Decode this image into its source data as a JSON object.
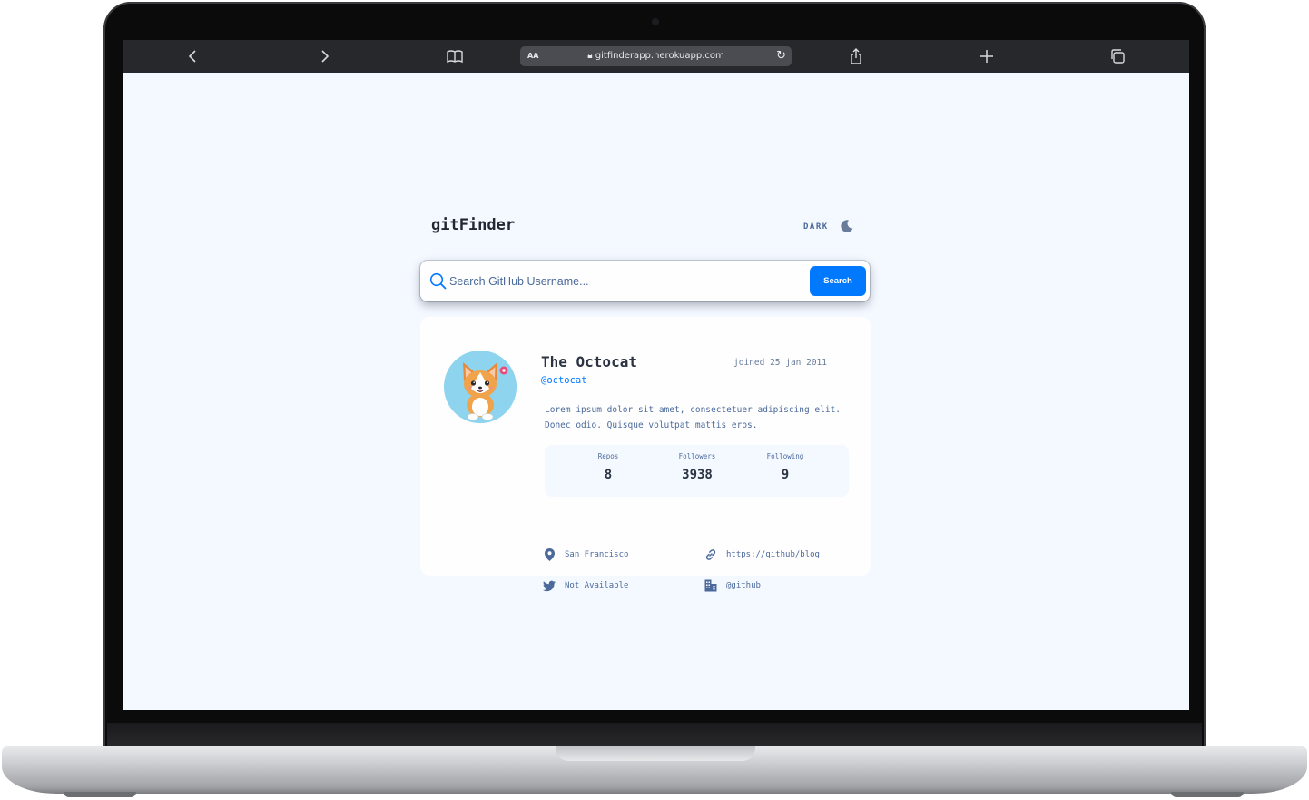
{
  "browser": {
    "text_size_label": "AA",
    "url": "gitfinderapp.herokuapp.com",
    "icons": [
      "back-icon",
      "forward-icon",
      "bookmarks-icon",
      "lock-icon",
      "reload-icon",
      "share-icon",
      "new-tab-icon",
      "tabs-icon"
    ]
  },
  "app": {
    "title": "gitFinder",
    "theme_toggle_label": "DARK",
    "theme_icon": "moon-icon"
  },
  "search": {
    "placeholder": "Search GitHub Username...",
    "value": "",
    "button_label": "Search"
  },
  "profile": {
    "name": "The Octocat",
    "login": "@octocat",
    "joined": "joined 25 jan 2011",
    "bio": "Lorem ipsum dolor sit amet, consectetuer adipiscing elit. Donec odio. Quisque volutpat mattis eros.",
    "avatar_icon": "corgi-avatar",
    "stats": {
      "repos_label": "Repos",
      "repos": "8",
      "followers_label": "Followers",
      "followers": "3938",
      "following_label": "Following",
      "following": "9"
    },
    "links": {
      "location": "San Francisco",
      "blog": "https://github/blog",
      "twitter": "Not Available",
      "company": "@github"
    }
  },
  "colors": {
    "accent": "#0079ff",
    "page_bg": "#f4f8ff",
    "card_bg": "#fefefe",
    "text_muted": "#4b6a9b",
    "toolbar": "#26282c"
  }
}
